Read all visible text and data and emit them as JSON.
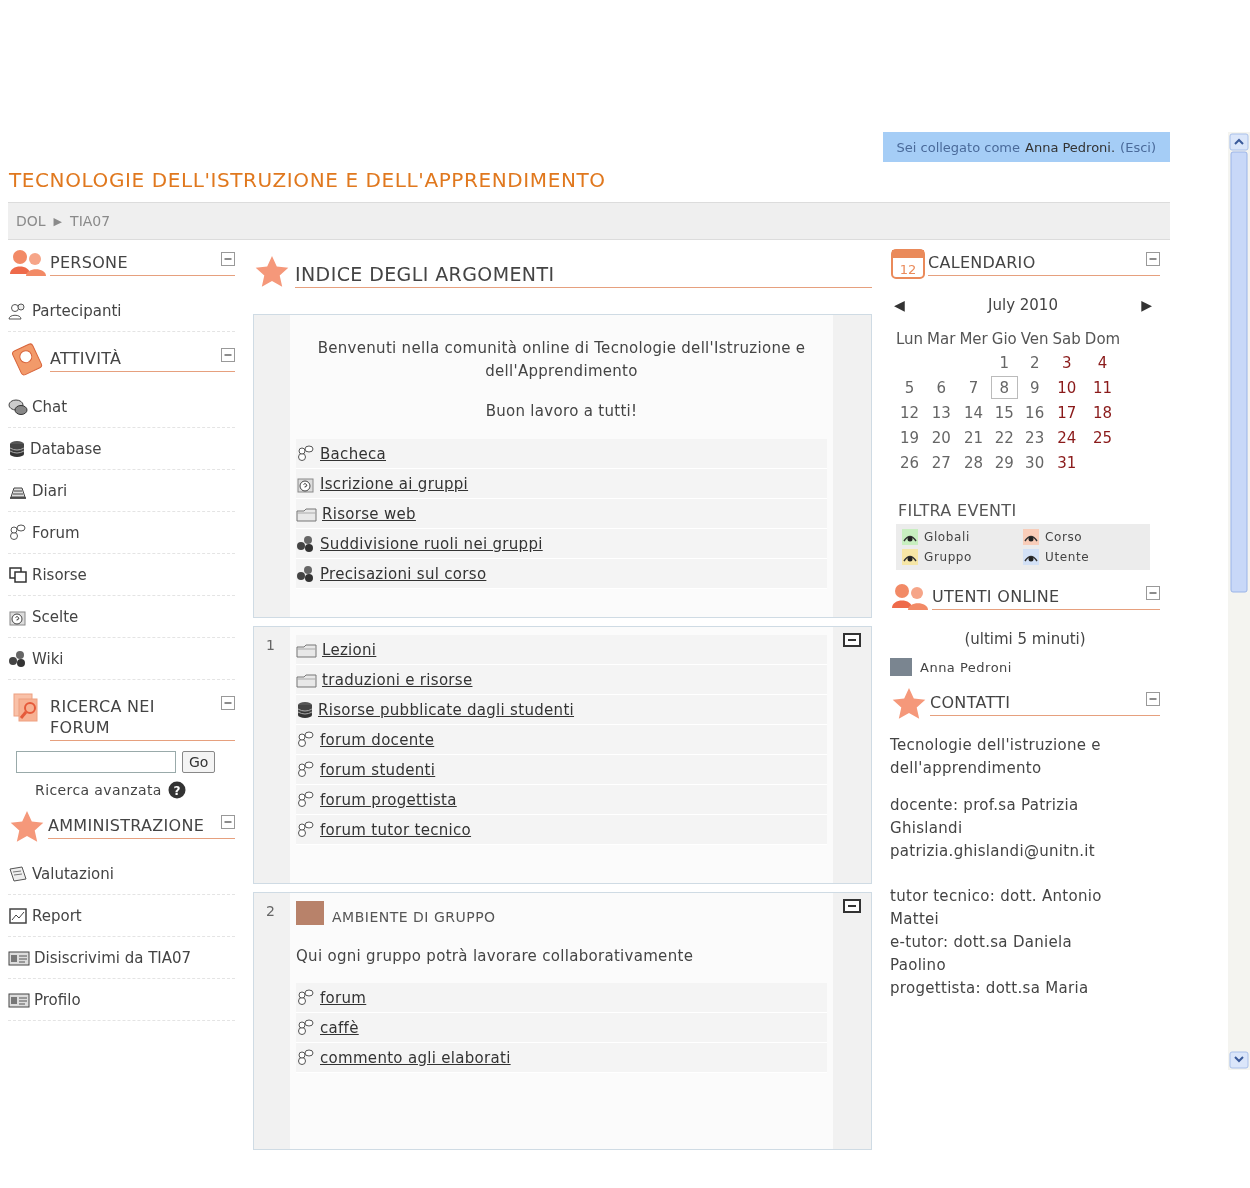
{
  "login_bar": {
    "prefix": "Sei collegato come",
    "user": "Anna Pedroni.",
    "logout": "(Esci)"
  },
  "course_title": "TECNOLOGIE DELL'ISTRUZIONE E DELL'APPRENDIMENTO",
  "breadcrumb": {
    "items": [
      "DOL",
      "TIA07"
    ],
    "separator": "▶"
  },
  "left_blocks": [
    {
      "kind": "people",
      "title": "PERSONE",
      "items": [
        {
          "kind": "group",
          "label": "Partecipanti"
        }
      ]
    },
    {
      "kind": "activity",
      "title": "ATTIVITÀ",
      "items": [
        {
          "kind": "chat",
          "label": "Chat"
        },
        {
          "kind": "database",
          "label": "Database"
        },
        {
          "kind": "diary",
          "label": "Diari"
        },
        {
          "kind": "forum",
          "label": "Forum"
        },
        {
          "kind": "resource",
          "label": "Risorse"
        },
        {
          "kind": "choice",
          "label": "Scelte"
        },
        {
          "kind": "wiki",
          "label": "Wiki"
        }
      ]
    },
    {
      "kind": "search",
      "title": "RICERCA NEI FORUM",
      "button": "Go",
      "advanced": "Ricerca avanzata",
      "help": "?"
    },
    {
      "kind": "star",
      "title": "AMMINISTRAZIONE",
      "items": [
        {
          "kind": "grades",
          "label": "Valutazioni"
        },
        {
          "kind": "report",
          "label": "Report"
        },
        {
          "kind": "card",
          "label": "Disiscrivimi da TIA07"
        },
        {
          "kind": "card",
          "label": "Profilo"
        }
      ]
    }
  ],
  "main": {
    "title": "INDICE DEGLI ARGOMENTI",
    "sections": [
      {
        "intro": [
          "Benvenuti nella comunità online di Tecnologie dell'Istruzione e dell'Apprendimento",
          "Buon lavoro a tutti!"
        ],
        "links": [
          {
            "kind": "forum",
            "label": "Bacheca"
          },
          {
            "kind": "choice",
            "label": "Iscrizione ai gruppi"
          },
          {
            "kind": "folder",
            "label": "Risorse web"
          },
          {
            "kind": "wiki",
            "label": "Suddivisione ruoli nei gruppi"
          },
          {
            "kind": "wiki",
            "label": "Precisazioni sul corso"
          }
        ]
      },
      {
        "number": "1",
        "links": [
          {
            "kind": "folder",
            "label": "Lezioni"
          },
          {
            "kind": "folder",
            "label": "traduzioni e risorse"
          },
          {
            "kind": "database",
            "label": "Risorse pubblicate dagli studenti"
          },
          {
            "kind": "forum",
            "label": "forum docente"
          },
          {
            "kind": "forum",
            "label": "forum studenti"
          },
          {
            "kind": "forum",
            "label": "forum progettista"
          },
          {
            "kind": "forum",
            "label": "forum tutor tecnico"
          }
        ]
      },
      {
        "number": "2",
        "heading": "AMBIENTE DI GRUPPO",
        "summary": "Qui ogni gruppo potrà lavorare collaborativamente",
        "links": [
          {
            "kind": "forum",
            "label": "forum"
          },
          {
            "kind": "forum",
            "label": "caffè"
          },
          {
            "kind": "forum",
            "label": "commento agli elaborati"
          }
        ]
      }
    ]
  },
  "right_blocks": [
    {
      "kind": "calendar",
      "title": "CALENDARIO",
      "icon_text": "12",
      "prev": "◀",
      "next": "▶",
      "month": "July 2010",
      "weekdays": [
        "Lun",
        "Mar",
        "Mer",
        "Gio",
        "Ven",
        "Sab",
        "Dom"
      ],
      "weeks": [
        [
          {
            "day": "1",
            "weekend": false,
            "today": false
          },
          {
            "day": "2",
            "weekend": false,
            "today": false
          },
          {
            "day": "3",
            "weekend": true,
            "today": false
          },
          {
            "day": "4",
            "weekend": true,
            "today": false
          }
        ],
        [
          {
            "day": "5",
            "weekend": false,
            "today": false
          },
          {
            "day": "6",
            "weekend": false,
            "today": false
          },
          {
            "day": "7",
            "weekend": false,
            "today": false
          },
          {
            "day": "8",
            "weekend": false,
            "today": true
          },
          {
            "day": "9",
            "weekend": false,
            "today": false
          },
          {
            "day": "10",
            "weekend": true,
            "today": false
          },
          {
            "day": "11",
            "weekend": true,
            "today": false
          }
        ],
        [
          {
            "day": "12",
            "weekend": false,
            "today": false
          },
          {
            "day": "13",
            "weekend": false,
            "today": false
          },
          {
            "day": "14",
            "weekend": false,
            "today": false
          },
          {
            "day": "15",
            "weekend": false,
            "today": false
          },
          {
            "day": "16",
            "weekend": false,
            "today": false
          },
          {
            "day": "17",
            "weekend": true,
            "today": false
          },
          {
            "day": "18",
            "weekend": true,
            "today": false
          }
        ],
        [
          {
            "day": "19",
            "weekend": false,
            "today": false
          },
          {
            "day": "20",
            "weekend": false,
            "today": false
          },
          {
            "day": "21",
            "weekend": false,
            "today": false
          },
          {
            "day": "22",
            "weekend": false,
            "today": false
          },
          {
            "day": "23",
            "weekend": false,
            "today": false
          },
          {
            "day": "24",
            "weekend": true,
            "today": false
          },
          {
            "day": "25",
            "weekend": true,
            "today": false
          }
        ],
        [
          {
            "day": "26",
            "weekend": false,
            "today": false
          },
          {
            "day": "27",
            "weekend": false,
            "today": false
          },
          {
            "day": "28",
            "weekend": false,
            "today": false
          },
          {
            "day": "29",
            "weekend": false,
            "today": false
          },
          {
            "day": "30",
            "weekend": false,
            "today": false
          },
          {
            "day": "31",
            "weekend": true,
            "today": false
          }
        ]
      ],
      "filter": {
        "title": "FILTRA EVENTI",
        "items": [
          {
            "label": "Globali",
            "color": "#c8efc0"
          },
          {
            "label": "Corso",
            "color": "#f9cdb9"
          },
          {
            "label": "Gruppo",
            "color": "#f6e6a6"
          },
          {
            "label": "Utente",
            "color": "#d3e1f6"
          }
        ]
      }
    },
    {
      "kind": "online",
      "title": "UTENTI ONLINE",
      "period": "(ultimi 5 minuti)",
      "users": [
        "Anna Pedroni"
      ]
    },
    {
      "kind": "contacts",
      "title": "CONTATTI",
      "paragraphs": [
        [
          "Tecnologie dell'istruzione e dell'apprendimento"
        ],
        [
          "docente: prof.sa Patrizia Ghislandi",
          "patrizia.ghislandi@unitn.it"
        ],
        [
          "tutor tecnico: dott. Antonio Mattei",
          "e-tutor: dott.sa Daniela Paolino",
          "progettista: dott.sa Maria"
        ]
      ]
    }
  ]
}
